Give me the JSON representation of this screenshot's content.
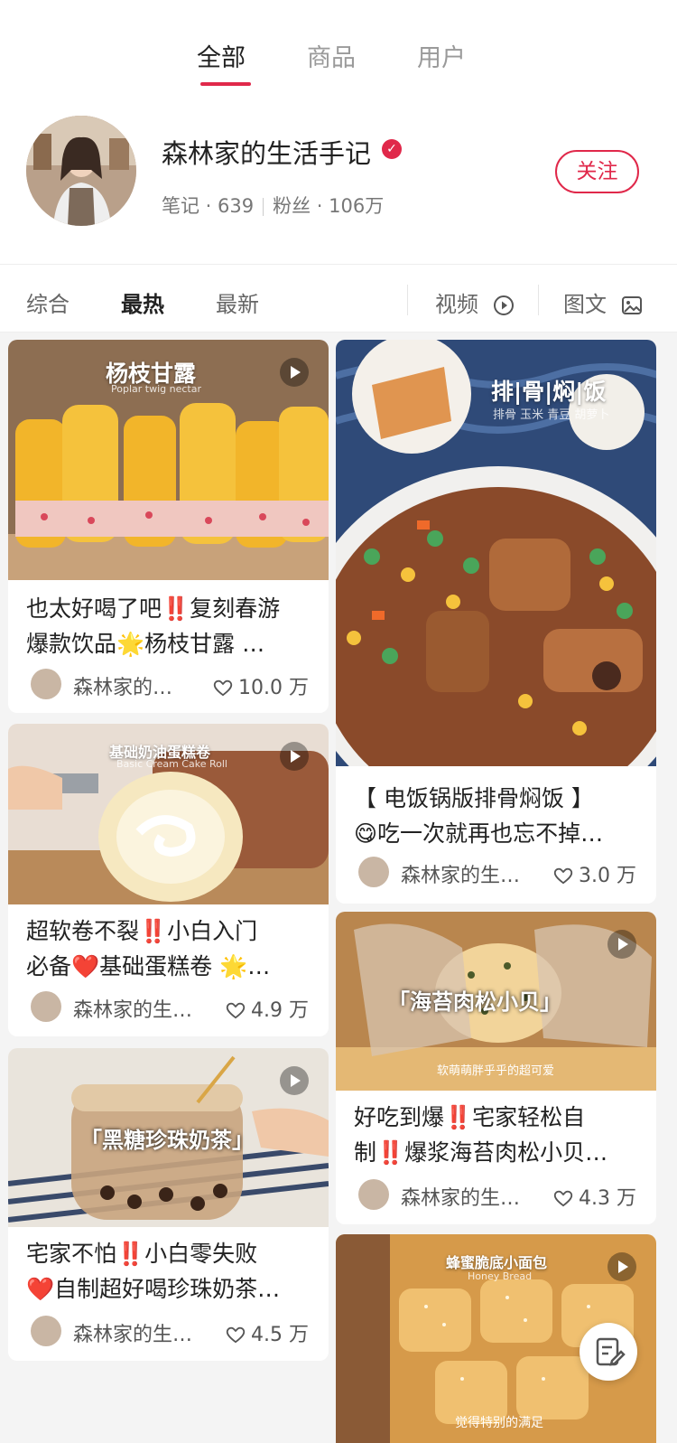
{
  "tabs": {
    "all": "全部",
    "goods": "商品",
    "users": "用户"
  },
  "user": {
    "name": "森林家的生活手记",
    "notes": "笔记 · 639",
    "fans": "粉丝 · 106万",
    "follow": "关注"
  },
  "filter": {
    "overall": "综合",
    "hot": "最热",
    "latest": "最新",
    "video": "视频",
    "image_text": "图文"
  },
  "cards": {
    "c1": {
      "img_title": "杨枝甘露",
      "img_sub": "Poplar twig nectar",
      "line1": "也太好喝了吧‼️复刻春游",
      "line2": "爆款饮品🌟杨枝甘露 …",
      "author": "森林家的…",
      "likes": "10.0 万"
    },
    "c2": {
      "img_title": "排|骨|焖|饭",
      "img_sub": "排骨 玉米 青豆 胡萝卜",
      "line1": "【 电饭锅版排骨焖饭 】",
      "line2": "😋吃一次就再也忘不掉…",
      "author": "森林家的生…",
      "likes": "3.0 万"
    },
    "c3": {
      "img_title": "基础奶油蛋糕卷",
      "img_sub": "Basic Cream Cake Roll",
      "line1": "超软卷不裂‼️小白入门",
      "line2": "必备❤️基础蛋糕卷 🌟…",
      "author": "森林家的生…",
      "likes": "4.9 万"
    },
    "c4": {
      "img_title": "「海苔肉松小贝」",
      "img_sub": "软萌萌胖乎乎的超可爱",
      "line1": "好吃到爆‼️宅家轻松自",
      "line2": "制‼️爆浆海苔肉松小贝…",
      "author": "森林家的生…",
      "likes": "4.3 万"
    },
    "c5": {
      "img_title": "「黑糖珍珠奶茶」",
      "img_sub": "",
      "line1": "宅家不怕‼️小白零失败",
      "line2": "❤️自制超好喝珍珠奶茶…",
      "author": "森林家的生…",
      "likes": "4.5 万"
    },
    "c6": {
      "img_title": "蜂蜜脆底小面包",
      "img_sub": "Honey Bread",
      "img_sub2": "觉得特别的满足"
    }
  },
  "colors": {
    "accent": "#e0284a"
  }
}
